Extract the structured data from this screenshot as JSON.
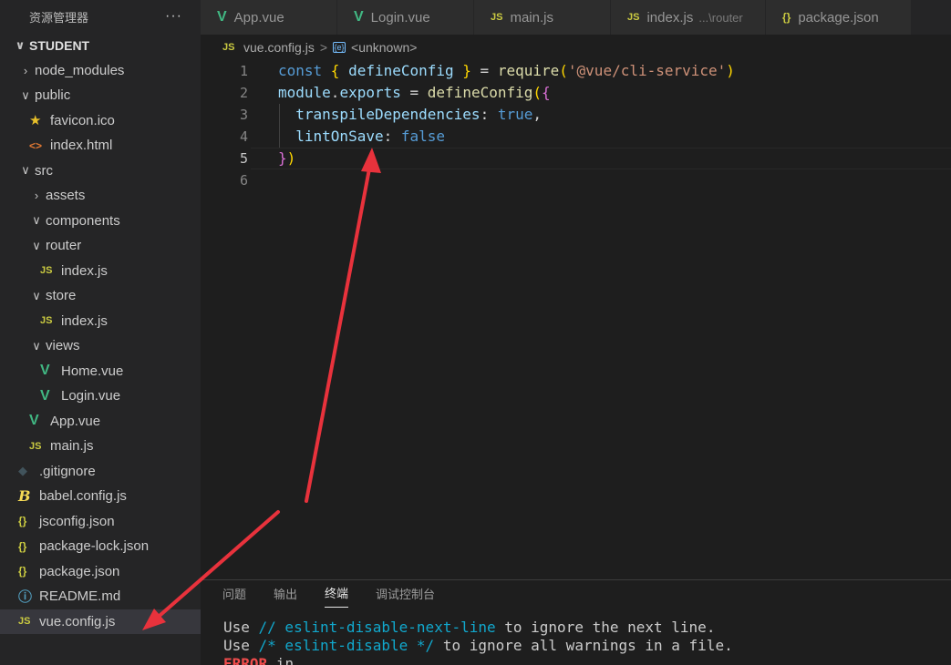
{
  "sidebar": {
    "title": "资源管理器",
    "more": "···",
    "tree": [
      {
        "label": "STUDENT",
        "chevron": "∨",
        "icon": "",
        "icon_name": "",
        "indent": 0,
        "root": true
      },
      {
        "label": "node_modules",
        "chevron": "›",
        "icon": "",
        "icon_name": "",
        "indent": 1
      },
      {
        "label": "public",
        "chevron": "∨",
        "icon": "",
        "icon_name": "",
        "indent": 1
      },
      {
        "label": "favicon.ico",
        "chevron": "",
        "icon": "★",
        "icon_name": "favicon-icon",
        "icon_class": "ic-star",
        "indent": 2
      },
      {
        "label": "index.html",
        "chevron": "",
        "icon": "<>",
        "icon_name": "html-icon",
        "icon_class": "ic-html",
        "indent": 2
      },
      {
        "label": "src",
        "chevron": "∨",
        "icon": "",
        "icon_name": "",
        "indent": 1
      },
      {
        "label": "assets",
        "chevron": "›",
        "icon": "",
        "icon_name": "",
        "indent": 2
      },
      {
        "label": "components",
        "chevron": "∨",
        "icon": "",
        "icon_name": "",
        "indent": 2
      },
      {
        "label": "router",
        "chevron": "∨",
        "icon": "",
        "icon_name": "",
        "indent": 2
      },
      {
        "label": "index.js",
        "chevron": "",
        "icon": "JS",
        "icon_name": "js-icon",
        "icon_class": "ic-js",
        "indent": 3
      },
      {
        "label": "store",
        "chevron": "∨",
        "icon": "",
        "icon_name": "",
        "indent": 2
      },
      {
        "label": "index.js",
        "chevron": "",
        "icon": "JS",
        "icon_name": "js-icon",
        "icon_class": "ic-js",
        "indent": 3
      },
      {
        "label": "views",
        "chevron": "∨",
        "icon": "",
        "icon_name": "",
        "indent": 2
      },
      {
        "label": "Home.vue",
        "chevron": "",
        "icon": "V",
        "icon_name": "vue-icon",
        "icon_class": "ic-vue",
        "indent": 3
      },
      {
        "label": "Login.vue",
        "chevron": "",
        "icon": "V",
        "icon_name": "vue-icon",
        "icon_class": "ic-vue",
        "indent": 3
      },
      {
        "label": "App.vue",
        "chevron": "",
        "icon": "V",
        "icon_name": "vue-icon",
        "icon_class": "ic-vue",
        "indent": 2
      },
      {
        "label": "main.js",
        "chevron": "",
        "icon": "JS",
        "icon_name": "js-icon",
        "icon_class": "ic-js",
        "indent": 2
      },
      {
        "label": ".gitignore",
        "chevron": "",
        "icon": "◆",
        "icon_name": "git-icon",
        "icon_class": "ic-git",
        "indent": 1
      },
      {
        "label": "babel.config.js",
        "chevron": "",
        "icon": "B",
        "icon_name": "babel-icon",
        "icon_class": "ic-babel",
        "indent": 1
      },
      {
        "label": "jsconfig.json",
        "chevron": "",
        "icon": "{}",
        "icon_name": "json-icon",
        "icon_class": "ic-json",
        "indent": 1
      },
      {
        "label": "package-lock.json",
        "chevron": "",
        "icon": "{}",
        "icon_name": "json-icon",
        "icon_class": "ic-json",
        "indent": 1
      },
      {
        "label": "package.json",
        "chevron": "",
        "icon": "{}",
        "icon_name": "json-icon",
        "icon_class": "ic-json",
        "indent": 1
      },
      {
        "label": "README.md",
        "chevron": "",
        "icon": "ⓘ",
        "icon_name": "info-icon",
        "icon_class": "ic-info",
        "indent": 1
      },
      {
        "label": "vue.config.js",
        "chevron": "",
        "icon": "JS",
        "icon_name": "js-icon",
        "icon_class": "ic-js",
        "indent": 1,
        "selected": true
      }
    ]
  },
  "tabs": [
    {
      "label": "App.vue",
      "icon": "V",
      "icon_name": "vue-icon",
      "icon_class": "ic-vue",
      "desc": ""
    },
    {
      "label": "Login.vue",
      "icon": "V",
      "icon_name": "vue-icon",
      "icon_class": "ic-vue",
      "desc": ""
    },
    {
      "label": "main.js",
      "icon": "JS",
      "icon_name": "js-icon",
      "icon_class": "ic-js",
      "desc": ""
    },
    {
      "label": "index.js",
      "icon": "JS",
      "icon_name": "js-icon",
      "icon_class": "ic-js",
      "desc": "...\\router"
    },
    {
      "label": "package.json",
      "icon": "{}",
      "icon_name": "json-icon",
      "icon_class": "ic-json",
      "desc": ""
    }
  ],
  "breadcrumb": {
    "file_icon": "JS",
    "file": "vue.config.js",
    "separator": ">",
    "symbol_icon": "{e}",
    "symbol": "<unknown>"
  },
  "editor": {
    "lines": [
      {
        "num": "1",
        "tokens": [
          [
            "kw",
            "const "
          ],
          [
            "br1",
            "{ "
          ],
          [
            "var",
            "defineConfig"
          ],
          [
            "br1",
            " }"
          ],
          [
            "",
            " = "
          ],
          [
            "fn",
            "require"
          ],
          [
            "br1",
            "("
          ],
          [
            "str",
            "'@vue/cli-service'"
          ],
          [
            "br1",
            ")"
          ]
        ]
      },
      {
        "num": "2",
        "tokens": [
          [
            "var",
            "module"
          ],
          [
            "",
            "."
          ],
          [
            "var",
            "exports"
          ],
          [
            "",
            " = "
          ],
          [
            "fn",
            "defineConfig"
          ],
          [
            "br1",
            "("
          ],
          [
            "br2",
            "{"
          ]
        ]
      },
      {
        "num": "3",
        "tokens": [
          [
            "",
            "  "
          ],
          [
            "var",
            "transpileDependencies"
          ],
          [
            "",
            ": "
          ],
          [
            "kw",
            "true"
          ],
          [
            "",
            ","
          ]
        ]
      },
      {
        "num": "4",
        "tokens": [
          [
            "",
            "  "
          ],
          [
            "var",
            "lintOnSave"
          ],
          [
            "",
            ": "
          ],
          [
            "kw",
            "false"
          ]
        ]
      },
      {
        "num": "5",
        "tokens": [
          [
            "br2",
            "}"
          ],
          [
            "br1",
            ")"
          ]
        ]
      },
      {
        "num": "6",
        "tokens": []
      }
    ],
    "active_line": "5"
  },
  "panel": {
    "tabs": [
      "问题",
      "输出",
      "终端",
      "调试控制台"
    ],
    "active_tab": "终端",
    "terminal": [
      [
        [
          "",
          "Use "
        ],
        [
          "tcyan",
          "// eslint-disable-next-line"
        ],
        [
          "",
          " to ignore the next line."
        ]
      ],
      [
        [
          "",
          "Use "
        ],
        [
          "tcyan",
          "/* eslint-disable */"
        ],
        [
          "",
          " to ignore all warnings in a file."
        ]
      ],
      [
        [
          "terr",
          "ERROR"
        ],
        [
          "",
          " in"
        ]
      ]
    ]
  },
  "annotation": {
    "arrow_color": "#e8323c"
  }
}
